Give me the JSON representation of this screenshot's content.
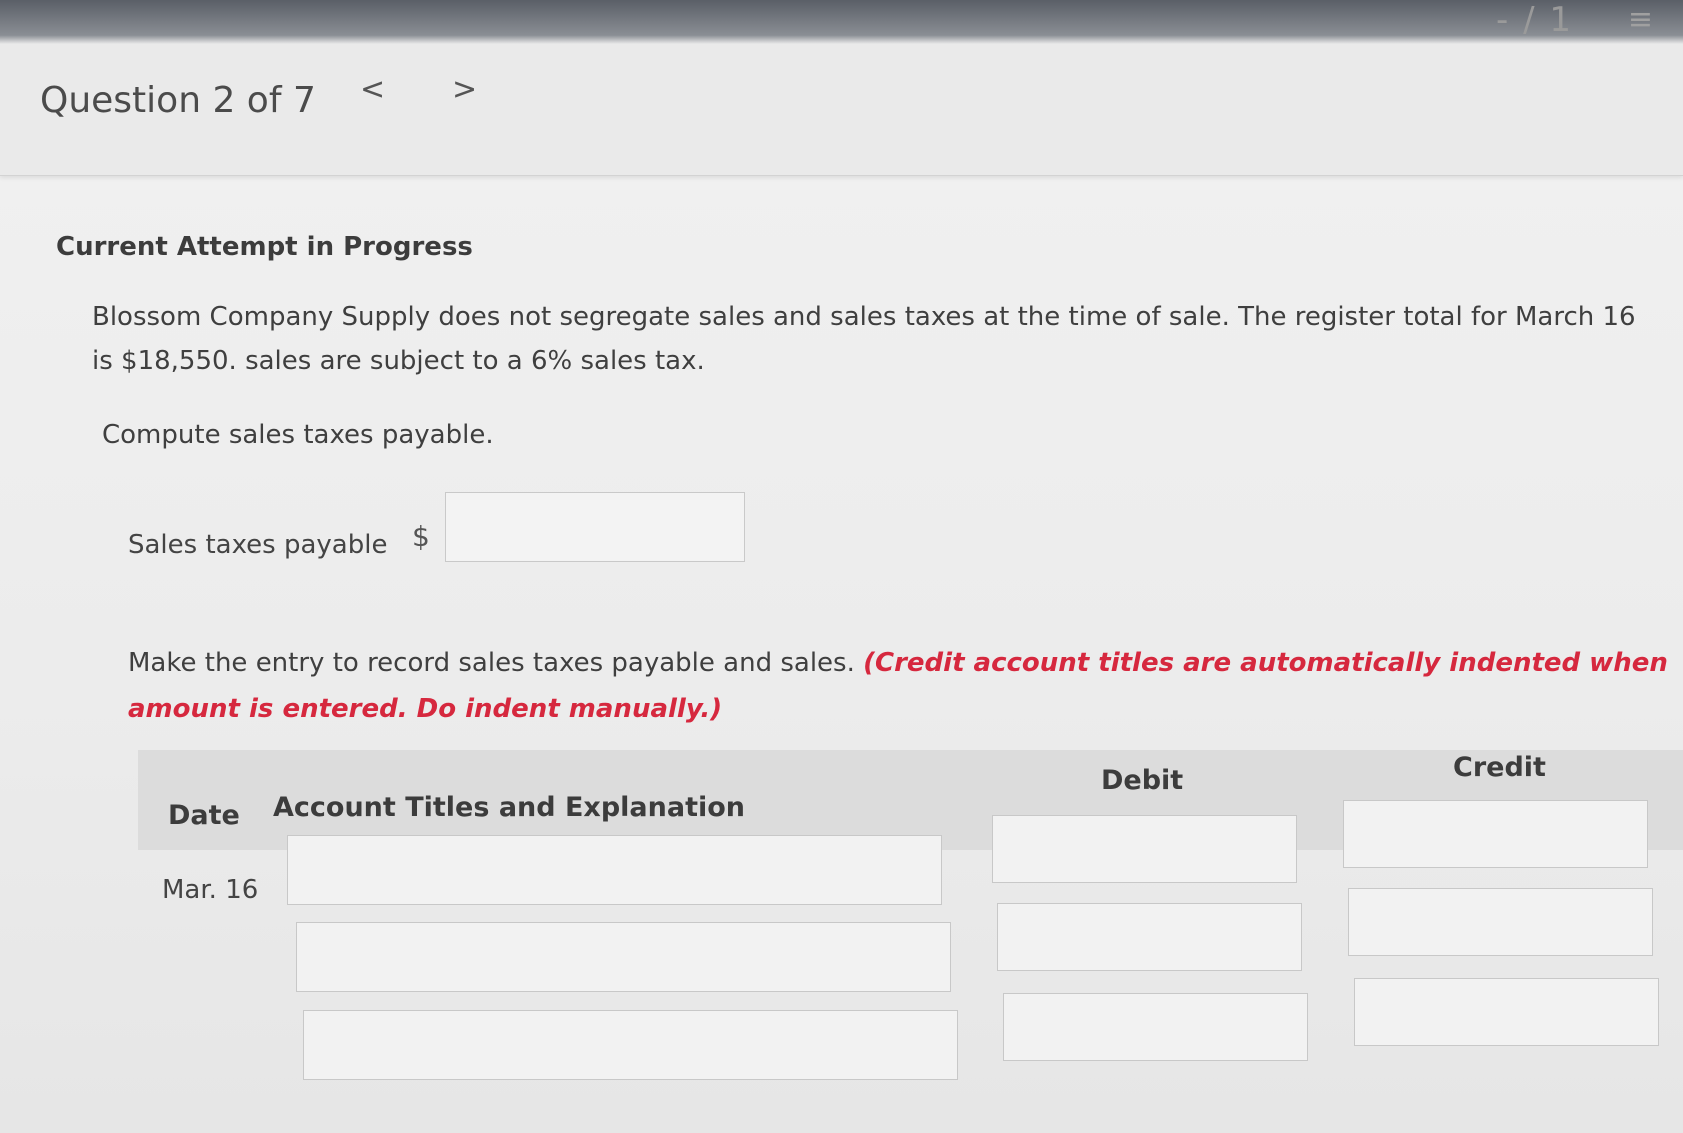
{
  "header": {
    "question_title": "Question 2 of 7",
    "prev_symbol": "<",
    "next_symbol": ">",
    "page_counter": "- / 1",
    "list_icon": "list-icon"
  },
  "content": {
    "heading": "Current Attempt in Progress",
    "problem": "Blossom Company Supply does not segregate sales and sales taxes at the time of sale. The register total for March 16 is $18,550. sales are subject to a 6% sales tax.",
    "instruction_compute": "Compute sales taxes payable.",
    "answer_label": "Sales taxes payable",
    "currency_symbol": "$",
    "instruction_entry": "Make the entry to record sales taxes payable and sales.",
    "instruction_note": "(Credit account titles are automatically indented when amount is entered. Do indent manually.)"
  },
  "journal": {
    "headers": {
      "date": "Date",
      "account": "Account Titles and Explanation",
      "debit": "Debit",
      "credit": "Credit"
    },
    "date_value": "Mar. 16"
  }
}
